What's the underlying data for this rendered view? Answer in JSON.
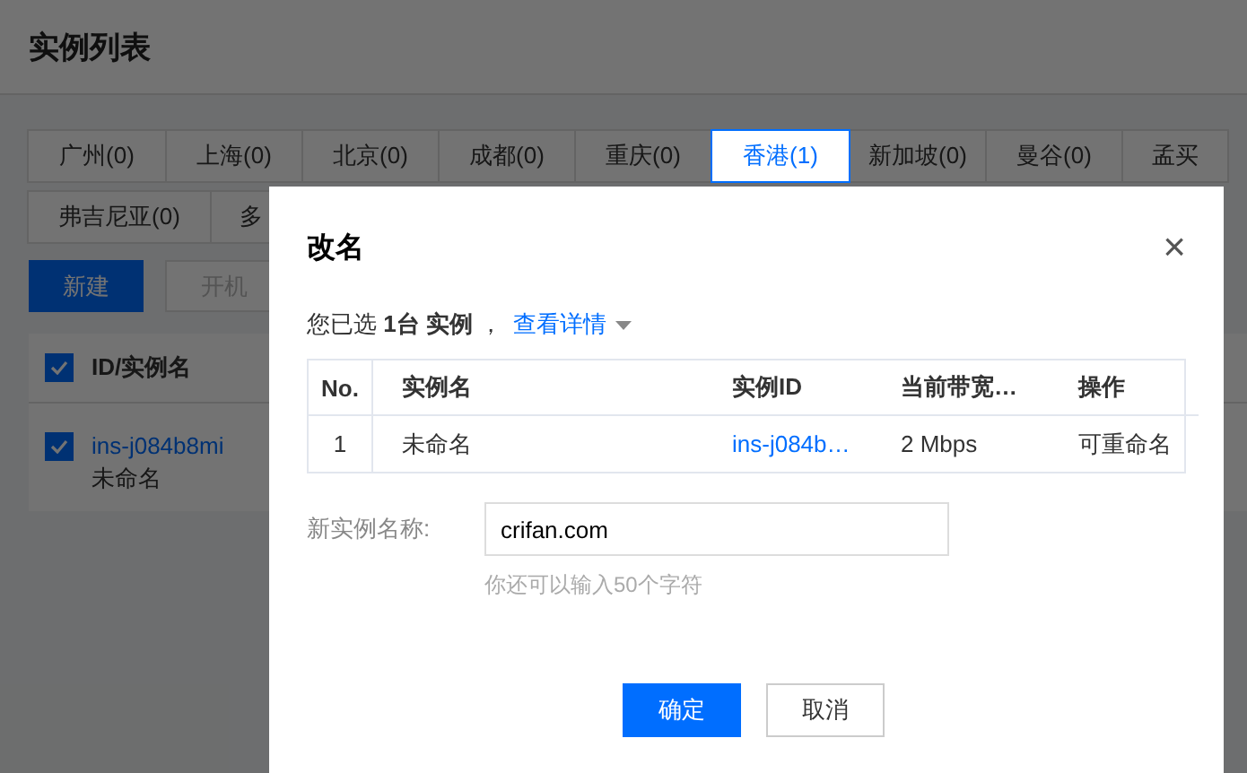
{
  "page": {
    "title": "实例列表",
    "regions": [
      {
        "label": "广州(0)",
        "selected": false
      },
      {
        "label": "上海(0)",
        "selected": false
      },
      {
        "label": "北京(0)",
        "selected": false
      },
      {
        "label": "成都(0)",
        "selected": false
      },
      {
        "label": "重庆(0)",
        "selected": false
      },
      {
        "label": "香港(1)",
        "selected": true
      },
      {
        "label": "新加坡(0)",
        "selected": false
      },
      {
        "label": "曼谷(0)",
        "selected": false
      },
      {
        "label": "孟买",
        "selected": false
      }
    ],
    "regions_row2": [
      {
        "label": "弗吉尼亚(0)",
        "selected": false
      },
      {
        "label": "多",
        "selected": false
      }
    ],
    "buttons": [
      {
        "label": "新建",
        "kind": "primary"
      },
      {
        "label": "开机",
        "kind": "disabled"
      }
    ],
    "table": {
      "header": {
        "label": "ID/实例名",
        "checked": true
      },
      "rows": [
        {
          "id": "ins-j084b8mi",
          "name": "未命名",
          "checked": true
        }
      ]
    }
  },
  "dialog": {
    "title": "改名",
    "close": "×",
    "summary": {
      "text": "您已选 **1台 实例** ，",
      "link": "查看详情"
    },
    "table": {
      "columns": [
        "No.",
        "实例名",
        "实例ID",
        "当前带宽…",
        "操作"
      ],
      "rows": [
        [
          "1",
          "未命名",
          "ins-j084b…",
          "2 Mbps",
          "可重命名"
        ]
      ]
    },
    "field": {
      "label": "新实例名称:",
      "value": "crifan.com",
      "hint": "你还可以输入50个字符"
    },
    "buttons": [
      {
        "label": "确定",
        "kind": "primary"
      },
      {
        "label": "取消",
        "kind": "secondary"
      }
    ]
  }
}
